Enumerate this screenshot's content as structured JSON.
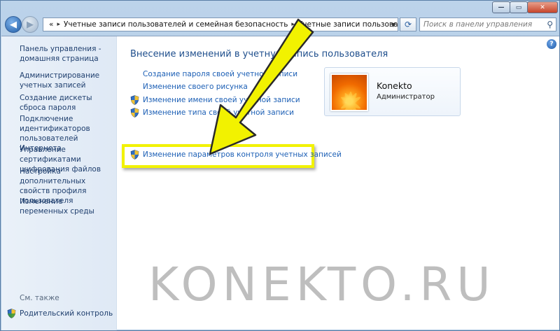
{
  "window": {
    "controls": {
      "minimize": "—",
      "maximize": "▭",
      "close": "✕"
    }
  },
  "nav": {
    "breadcrumb_prefix": "«",
    "breadcrumb": [
      "Учетные записи пользователей и семейная безопасность",
      "Учетные записи пользователей"
    ],
    "separator": "▸",
    "search_placeholder": "Поиск в панели управления"
  },
  "sidebar": {
    "items": [
      "Панель управления - домашняя страница",
      "Администрирование учетных записей",
      "Создание дискеты сброса пароля",
      "Подключение идентификаторов пользователей Интернета",
      "Управление сертификатами шифрования файлов",
      "Настройка дополнительных свойств профиля пользователя",
      "Изменение переменных среды"
    ],
    "see_also": "См. также",
    "parental_control": "Родительский контроль"
  },
  "main": {
    "title": "Внесение изменений в учетную запись пользователя",
    "tasks": [
      {
        "label": "Создание пароля своей учетной записи",
        "shield": false
      },
      {
        "label": "Изменение своего рисунка",
        "shield": false
      },
      {
        "label": "Изменение имени своей учетной записи",
        "shield": true
      },
      {
        "label": "Изменение типа своей учетной записи",
        "shield": true
      }
    ],
    "highlighted_task": "Изменение параметров контроля учетных записей"
  },
  "account": {
    "name": "Konekto",
    "role": "Администратор"
  },
  "help_label": "?",
  "watermark": "KONEKTO.RU",
  "colors": {
    "link": "#1c5fb5",
    "highlight": "#f2f200",
    "arrow": "#f2f200"
  }
}
